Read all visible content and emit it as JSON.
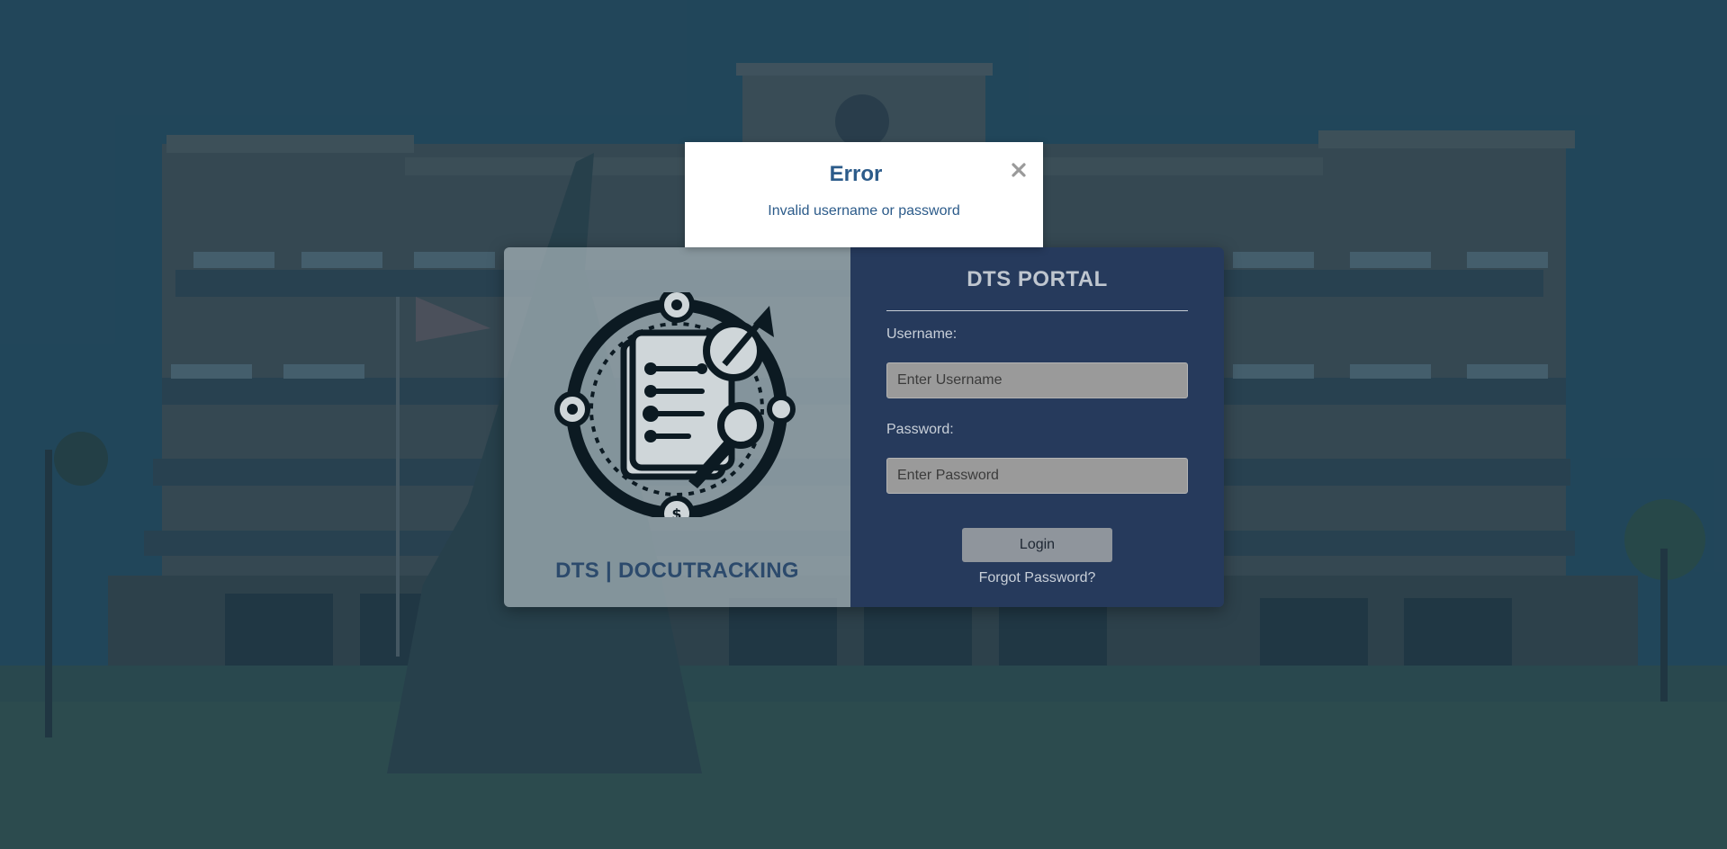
{
  "modal": {
    "title": "Error",
    "message": "Invalid username or password",
    "close_icon": "close-icon"
  },
  "brand": {
    "logo_icon": "document-tracking-logo-icon",
    "title": "DTS | DOCUTRACKING"
  },
  "form": {
    "title": "DTS PORTAL",
    "username_label": "Username:",
    "username_placeholder": "Enter Username",
    "username_value": "",
    "password_label": "Password:",
    "password_placeholder": "Enter Password",
    "password_value": "",
    "login_label": "Login",
    "forgot_label": "Forgot Password?"
  },
  "colors": {
    "overlay": "#1f4658",
    "form_panel": "#263a5c",
    "brand_panel": "#a8b4ba",
    "accent_text": "#2c5b8a",
    "button": "#8f959c"
  }
}
